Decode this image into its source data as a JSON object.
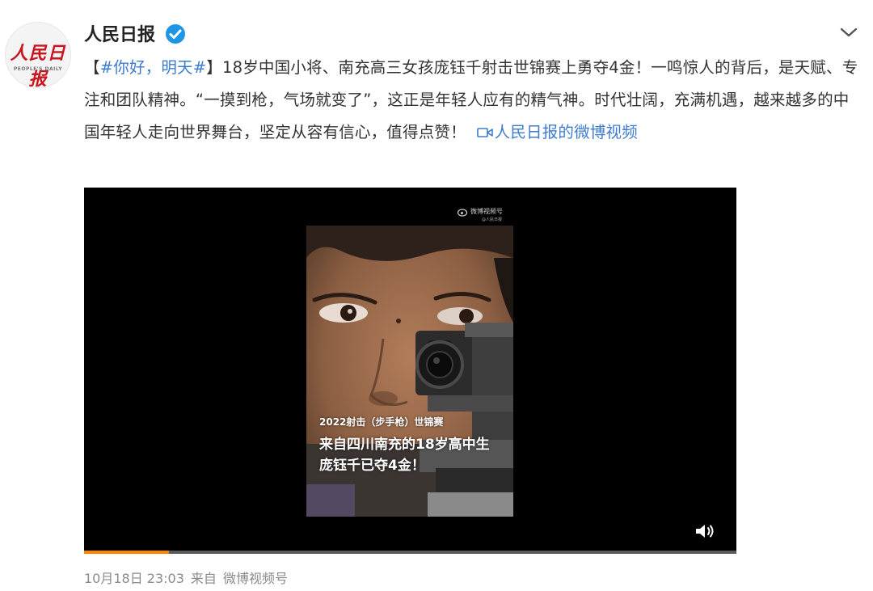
{
  "author": {
    "name": "人民日报",
    "verified": true,
    "avatar_logo_text": "人民日报",
    "avatar_logo_sub": "PEOPLE'S DAILY"
  },
  "post": {
    "bracket_open": "【",
    "hashtag": "#你好，明天#",
    "bracket_close": "】",
    "body": "18岁中国小将、南充高三女孩庞钰千射击世锦赛上勇夺4金！一鸣惊人的背后，是天赋、专注和团队精神。“一摸到枪，气场就变了”，这正是年轻人应有的精气神。时代壮阔，充满机遇，越来越多的中国年轻人走向世界舞台，坚定从容有信心，值得点赞！",
    "video_link_text": "人民日报的微博视频"
  },
  "video": {
    "watermark_title": "微博视频号",
    "watermark_sub": "@人民日报",
    "caption_line1": "2022射击（步手枪）世锦赛",
    "caption_line2": "来自四川南充的18岁高中生",
    "caption_line3": "庞钰千已夺4金！",
    "progress": 0.13
  },
  "meta": {
    "time": "10月18日 23:03",
    "from_label": "来自",
    "source": "微博视频号"
  },
  "colors": {
    "link": "#3d7bcf",
    "verified_badge": "#1e96e6",
    "progress_fill": "#ff8200",
    "logo_red": "#c8161e"
  },
  "icons": {
    "verified": "verified-badge-icon",
    "menu": "chevron-down-icon",
    "video_link": "video-link-icon",
    "volume": "volume-icon"
  }
}
